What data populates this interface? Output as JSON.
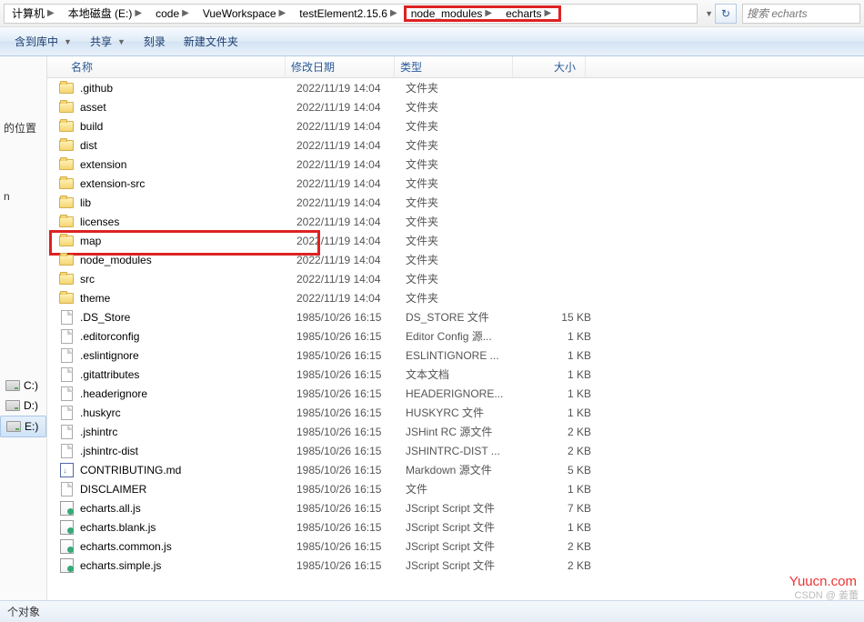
{
  "breadcrumb": [
    {
      "label": "计算机"
    },
    {
      "label": "本地磁盘 (E:)"
    },
    {
      "label": "code"
    },
    {
      "label": "VueWorkspace"
    },
    {
      "label": "testElement2.15.6"
    },
    {
      "label": "node_modules"
    },
    {
      "label": "echarts"
    }
  ],
  "breadcrumb_highlight_range": [
    5,
    6
  ],
  "search": {
    "placeholder": "搜索 echarts"
  },
  "toolbar": {
    "include": "含到库中",
    "share": "共享",
    "burn": "刻录",
    "new_folder": "新建文件夹"
  },
  "sidebar": {
    "location_label": "的位置",
    "unknown": "n",
    "drives": [
      "C:)",
      "D:)",
      "E:)"
    ],
    "selected_drive_index": 2
  },
  "columns": {
    "name": "名称",
    "date": "修改日期",
    "type": "类型",
    "size": "大小"
  },
  "rows": [
    {
      "icon": "folder",
      "name": ".github",
      "date": "2022/11/19 14:04",
      "type": "文件夹",
      "size": ""
    },
    {
      "icon": "folder",
      "name": "asset",
      "date": "2022/11/19 14:04",
      "type": "文件夹",
      "size": ""
    },
    {
      "icon": "folder",
      "name": "build",
      "date": "2022/11/19 14:04",
      "type": "文件夹",
      "size": ""
    },
    {
      "icon": "folder",
      "name": "dist",
      "date": "2022/11/19 14:04",
      "type": "文件夹",
      "size": ""
    },
    {
      "icon": "folder",
      "name": "extension",
      "date": "2022/11/19 14:04",
      "type": "文件夹",
      "size": ""
    },
    {
      "icon": "folder",
      "name": "extension-src",
      "date": "2022/11/19 14:04",
      "type": "文件夹",
      "size": ""
    },
    {
      "icon": "folder",
      "name": "lib",
      "date": "2022/11/19 14:04",
      "type": "文件夹",
      "size": ""
    },
    {
      "icon": "folder",
      "name": "licenses",
      "date": "2022/11/19 14:04",
      "type": "文件夹",
      "size": ""
    },
    {
      "icon": "folder",
      "name": "map",
      "date": "2022/11/19 14:04",
      "type": "文件夹",
      "size": "",
      "hl": true
    },
    {
      "icon": "folder",
      "name": "node_modules",
      "date": "2022/11/19 14:04",
      "type": "文件夹",
      "size": ""
    },
    {
      "icon": "folder",
      "name": "src",
      "date": "2022/11/19 14:04",
      "type": "文件夹",
      "size": ""
    },
    {
      "icon": "folder",
      "name": "theme",
      "date": "2022/11/19 14:04",
      "type": "文件夹",
      "size": ""
    },
    {
      "icon": "file",
      "name": ".DS_Store",
      "date": "1985/10/26 16:15",
      "type": "DS_STORE 文件",
      "size": "15 KB"
    },
    {
      "icon": "file",
      "name": ".editorconfig",
      "date": "1985/10/26 16:15",
      "type": "Editor Config 源...",
      "size": "1 KB"
    },
    {
      "icon": "file",
      "name": ".eslintignore",
      "date": "1985/10/26 16:15",
      "type": "ESLINTIGNORE ...",
      "size": "1 KB"
    },
    {
      "icon": "file",
      "name": ".gitattributes",
      "date": "1985/10/26 16:15",
      "type": "文本文档",
      "size": "1 KB"
    },
    {
      "icon": "file",
      "name": ".headerignore",
      "date": "1985/10/26 16:15",
      "type": "HEADERIGNORE...",
      "size": "1 KB"
    },
    {
      "icon": "file",
      "name": ".huskyrc",
      "date": "1985/10/26 16:15",
      "type": "HUSKYRC 文件",
      "size": "1 KB"
    },
    {
      "icon": "file",
      "name": ".jshintrc",
      "date": "1985/10/26 16:15",
      "type": "JSHint RC 源文件",
      "size": "2 KB"
    },
    {
      "icon": "file",
      "name": ".jshintrc-dist",
      "date": "1985/10/26 16:15",
      "type": "JSHINTRC-DIST ...",
      "size": "2 KB"
    },
    {
      "icon": "md",
      "name": "CONTRIBUTING.md",
      "date": "1985/10/26 16:15",
      "type": "Markdown 源文件",
      "size": "5 KB"
    },
    {
      "icon": "file",
      "name": "DISCLAIMER",
      "date": "1985/10/26 16:15",
      "type": "文件",
      "size": "1 KB"
    },
    {
      "icon": "js",
      "name": "echarts.all.js",
      "date": "1985/10/26 16:15",
      "type": "JScript Script 文件",
      "size": "7 KB"
    },
    {
      "icon": "js",
      "name": "echarts.blank.js",
      "date": "1985/10/26 16:15",
      "type": "JScript Script 文件",
      "size": "1 KB"
    },
    {
      "icon": "js",
      "name": "echarts.common.js",
      "date": "1985/10/26 16:15",
      "type": "JScript Script 文件",
      "size": "2 KB"
    },
    {
      "icon": "js",
      "name": "echarts.simple.js",
      "date": "1985/10/26 16:15",
      "type": "JScript Script 文件",
      "size": "2 KB"
    }
  ],
  "status": {
    "text": "个对象"
  },
  "watermark": "Yuucn.com",
  "csdn": "CSDN @ 姜蕾"
}
